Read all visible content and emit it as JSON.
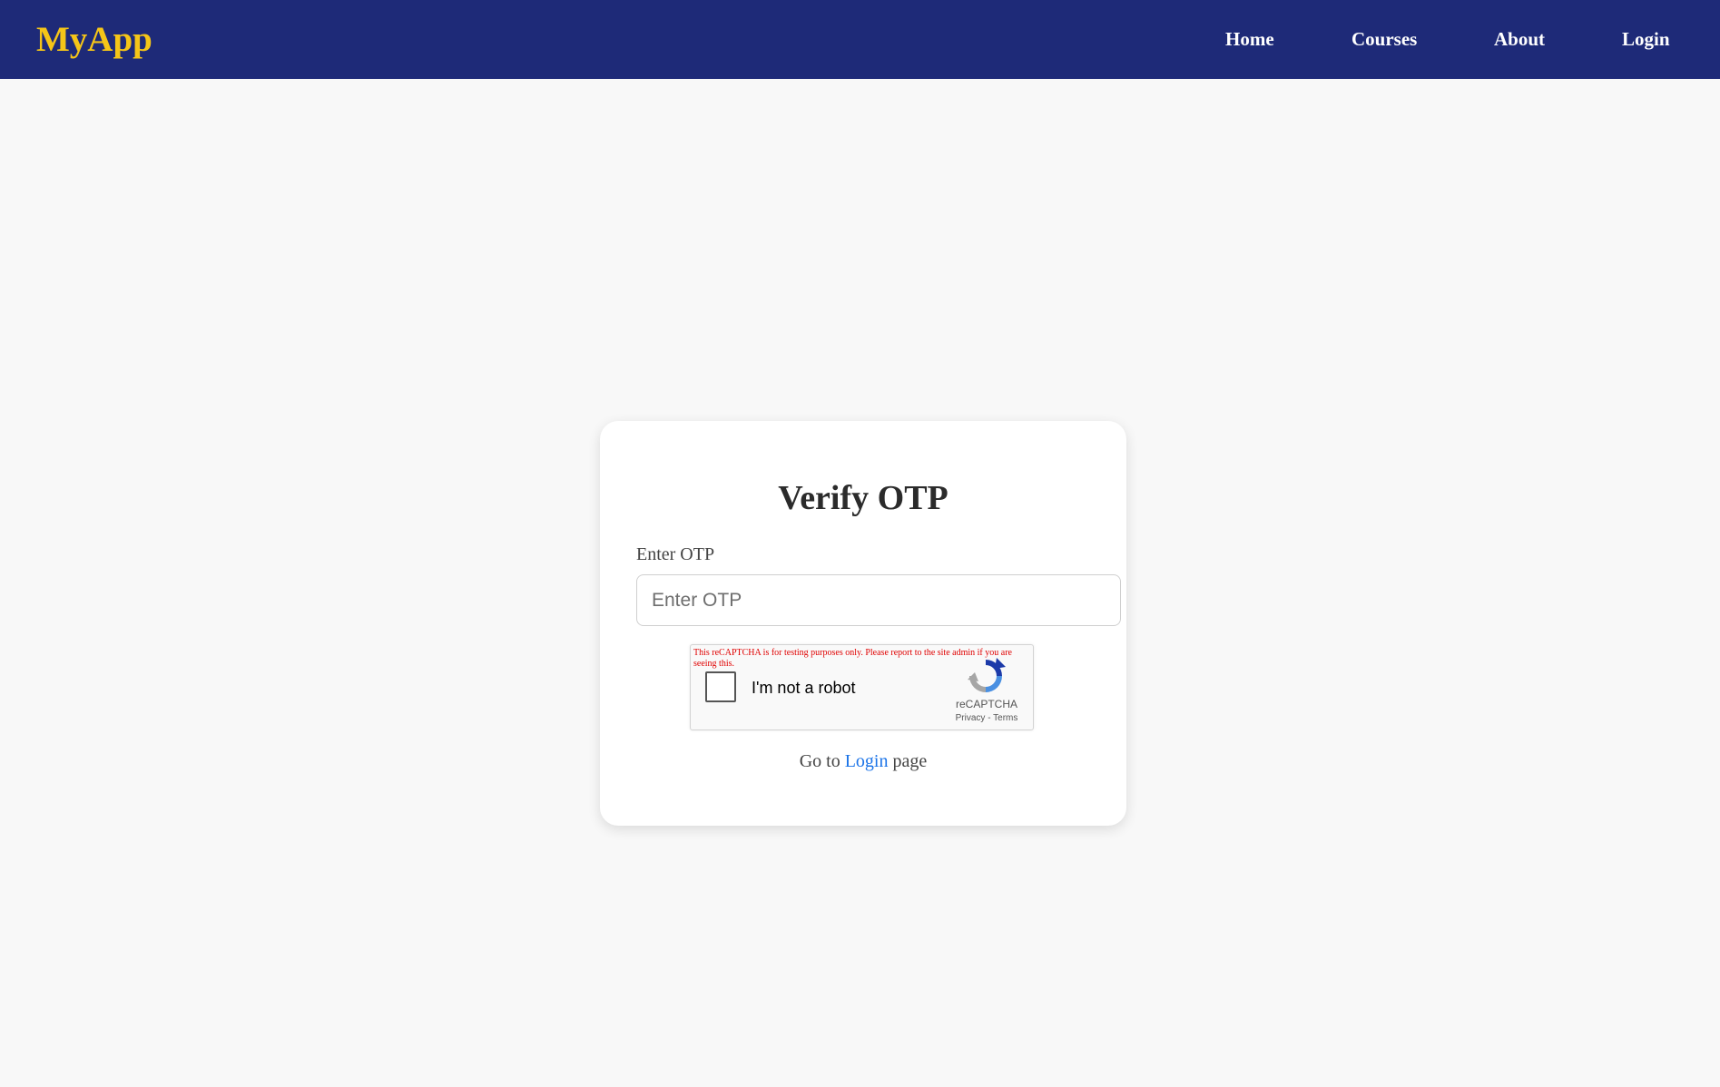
{
  "navbar": {
    "brand": "MyApp",
    "links": [
      {
        "label": "Home"
      },
      {
        "label": "Courses"
      },
      {
        "label": "About"
      },
      {
        "label": "Login"
      }
    ],
    "background_color": "#1e2a78",
    "brand_color": "#f5c518"
  },
  "card": {
    "title": "Verify OTP",
    "otp_label": "Enter OTP",
    "otp_placeholder": "Enter OTP",
    "otp_value": ""
  },
  "recaptcha": {
    "warning": "This reCAPTCHA is for testing purposes only. Please report to the site admin if you are seeing this.",
    "checkbox_label": "I'm not a robot",
    "brand": "reCAPTCHA",
    "privacy": "Privacy",
    "separator": " - ",
    "terms": "Terms",
    "checked": false
  },
  "footer": {
    "prefix": "Go to ",
    "link": "Login",
    "suffix": " page",
    "link_color": "#1a73e8"
  }
}
